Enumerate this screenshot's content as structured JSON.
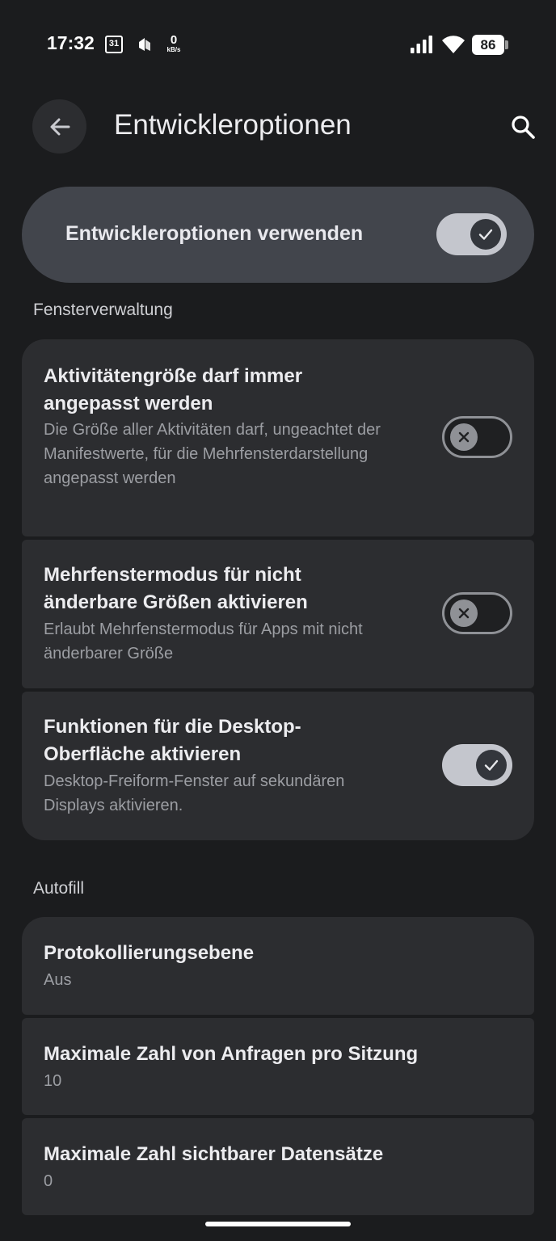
{
  "status_bar": {
    "time": "17:32",
    "calendar_day": "31",
    "net_speed_value": "0",
    "net_speed_unit": "kB/s",
    "battery": "86"
  },
  "header": {
    "title": "Entwickleroptionen"
  },
  "main_toggle": {
    "label": "Entwickleroptionen verwenden",
    "checked": true
  },
  "sections": {
    "window": {
      "header": "Fensterverwaltung",
      "items": [
        {
          "title": "Aktivitätengröße darf immer angepasst werden",
          "description": "Die Größe aller Aktivitäten darf, ungeachtet der Manifestwerte, für die Mehrfensterdarstellung angepasst werden",
          "checked": false
        },
        {
          "title": "Mehrfenstermodus für nicht änderbare Größen aktivieren",
          "description": "Erlaubt Mehrfenstermodus für Apps mit nicht änderbarer Größe",
          "checked": false
        },
        {
          "title": "Funktionen für die Desktop-Oberfläche aktivieren",
          "description": "Desktop-Freiform-Fenster auf sekundären Displays aktivieren.",
          "checked": true
        }
      ]
    },
    "autofill": {
      "header": "Autofill",
      "items": [
        {
          "title": "Protokollierungsebene",
          "value": "Aus"
        },
        {
          "title": "Maximale Zahl von Anfragen pro Sitzung",
          "value": "10"
        },
        {
          "title": "Maximale Zahl sichtbarer Datensätze",
          "value": "0"
        }
      ]
    }
  },
  "colors": {
    "background": "#1b1c1e",
    "card": "#2c2d30",
    "main_toggle_card": "#42454c",
    "switch_on_track": "#c4c6cd",
    "switch_off_outline": "#8f9196"
  }
}
